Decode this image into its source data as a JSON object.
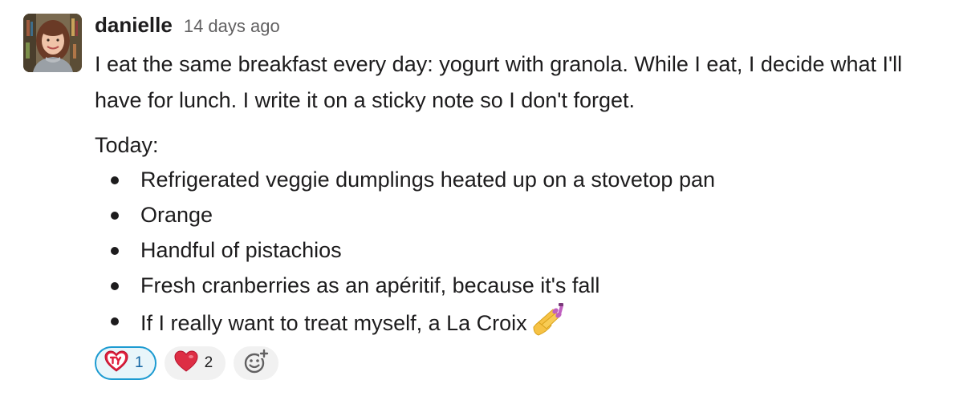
{
  "message": {
    "author": "danielle",
    "timestamp": "14 days ago",
    "paragraph": "I eat the same breakfast every day: yogurt with granola. While I eat, I decide what I'll have for lunch. I write it on a sticky note so I don't forget.",
    "list_title": "Today:",
    "items": [
      "Refrigerated veggie dumplings heated up on a stovetop pan",
      "Orange",
      "Handful of pistachios",
      "Fresh cranberries as an apéritif, because it's fall",
      "If I really want to treat myself, a La Croix"
    ],
    "last_item_emoji": "nail-polish-icon"
  },
  "reactions": [
    {
      "icon": "ty-heart-icon",
      "count": "1",
      "selected": true
    },
    {
      "icon": "red-heart-icon",
      "count": "2",
      "selected": false
    }
  ],
  "add_reaction_icon": "add-emoji-icon",
  "colors": {
    "text": "#1d1c1d",
    "timestamp": "#616061",
    "reaction_selected_border": "#1d9bd1",
    "reaction_selected_bg": "#e8f5fa",
    "reaction_bg": "#f1f1f1",
    "heart": "#e01e5a"
  }
}
